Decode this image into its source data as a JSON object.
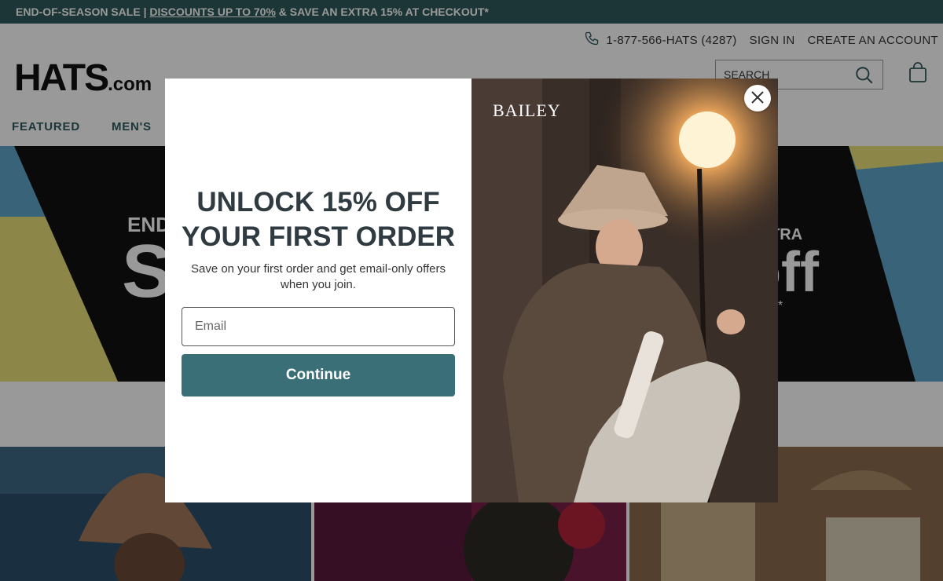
{
  "promo": {
    "prefix": "END-OF-SEASON SALE | ",
    "link": "DISCOUNTS UP TO 70%",
    "suffix": " & SAVE AN EXTRA 15% AT CHECKOUT*"
  },
  "header": {
    "phone": "1-877-566-HATS (4287)",
    "sign_in": "SIGN IN",
    "create_account": "CREATE AN ACCOUNT",
    "logo_main": "HATS",
    "logo_suffix": ".com",
    "search_placeholder": "SEARCH"
  },
  "nav": [
    "FEATURED",
    "MEN'S"
  ],
  "hero": {
    "line_a": "END-",
    "line_b": "SA",
    "line_c": "TRA",
    "line_d": "off",
    "line_e": "*"
  },
  "modal": {
    "title_line1": "UNLOCK 15% OFF",
    "title_line2": "YOUR FIRST ORDER",
    "subtitle": "Save on your first order and get email-only offers when you join.",
    "email_placeholder": "Email",
    "continue_label": "Continue",
    "brand": "BAILEY"
  },
  "colors": {
    "promo_bar": "#2f5a5c",
    "accent": "#3a6f77",
    "nav_text": "#2f5a5c"
  }
}
